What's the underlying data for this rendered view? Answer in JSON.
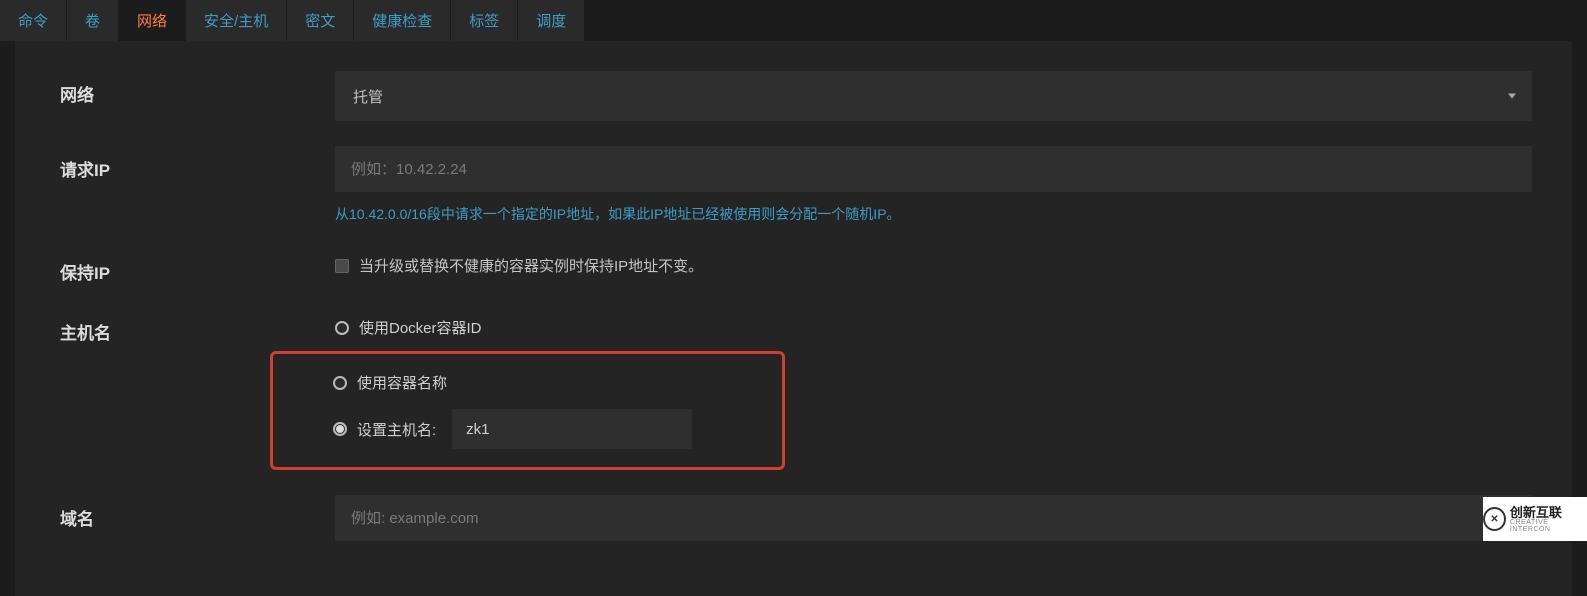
{
  "tabs": [
    {
      "key": "cmd",
      "label": "命令"
    },
    {
      "key": "vol",
      "label": "卷"
    },
    {
      "key": "net",
      "label": "网络",
      "active": true
    },
    {
      "key": "sec",
      "label": "安全/主机"
    },
    {
      "key": "secret",
      "label": "密文"
    },
    {
      "key": "health",
      "label": "健康检查"
    },
    {
      "key": "tags",
      "label": "标签"
    },
    {
      "key": "sched",
      "label": "调度"
    }
  ],
  "labels": {
    "network": "网络",
    "request_ip": "请求IP",
    "retain_ip": "保持IP",
    "hostname": "主机名",
    "domain": "域名"
  },
  "network": {
    "selected": "托管"
  },
  "request_ip": {
    "placeholder": "例如：10.42.2.24",
    "help": "从10.42.0.0/16段中请求一个指定的IP地址，如果此IP地址已经被使用则会分配一个随机IP。"
  },
  "retain_ip": {
    "checkbox_label": "当升级或替换不健康的容器实例时保持IP地址不变。",
    "checked": false
  },
  "hostname": {
    "options": {
      "docker_id": "使用Docker容器ID",
      "container_name": "使用容器名称",
      "custom": "设置主机名:"
    },
    "selected": "custom",
    "value": "zk1"
  },
  "domain": {
    "placeholder": "例如: example.com"
  },
  "watermark": {
    "title": "创新互联",
    "sub": "CREATIVE INTERCON"
  }
}
